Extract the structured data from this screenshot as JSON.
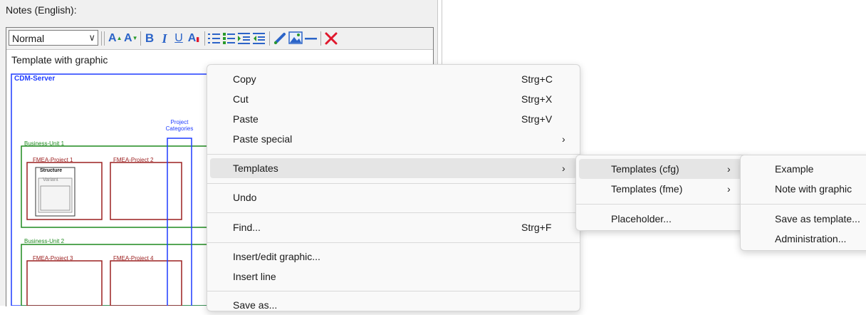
{
  "notes_label": "Notes (English):",
  "toolbar": {
    "style_value": "Normal",
    "grow_font": "A",
    "shrink_font": "A",
    "bold": "B",
    "italic": "I",
    "underline": "U",
    "font_color": "A",
    "icons": [
      "grow-font-icon",
      "shrink-font-icon",
      "bold-icon",
      "italic-icon",
      "underline-icon",
      "font-color-icon",
      "numbered-list-icon",
      "bullet-list-icon",
      "indent-icon",
      "outdent-icon",
      "link-icon",
      "insert-image-icon",
      "horizontal-line-icon",
      "delete-icon"
    ]
  },
  "document": {
    "text": "Template with graphic",
    "graphic": {
      "server": "CDM-Server",
      "project_categories": [
        "Project",
        "Categories"
      ],
      "bu1": "Business-Unit 1",
      "bu2": "Business-Unit 2",
      "p1": "FMEA-Project 1",
      "p2": "FMEA-Project 2",
      "p3": "FMEA-Project 3",
      "p4": "FMEA-Project 4",
      "structure": "Structure",
      "variant": "Variant"
    }
  },
  "context_menu": {
    "copy": {
      "label": "Copy",
      "shortcut": "Strg+C"
    },
    "cut": {
      "label": "Cut",
      "shortcut": "Strg+X"
    },
    "paste": {
      "label": "Paste",
      "shortcut": "Strg+V"
    },
    "paste_special": {
      "label": "Paste special",
      "arrow": "›"
    },
    "templates": {
      "label": "Templates",
      "arrow": "›"
    },
    "undo": {
      "label": "Undo"
    },
    "find": {
      "label": "Find...",
      "shortcut": "Strg+F"
    },
    "insert_graphic": {
      "label": "Insert/edit graphic..."
    },
    "insert_line": {
      "label": "Insert line"
    },
    "save_as": {
      "label": "Save as..."
    }
  },
  "templates_menu": {
    "cfg": {
      "label": "Templates (cfg)",
      "arrow": "›"
    },
    "fme": {
      "label": "Templates (fme)",
      "arrow": "›"
    },
    "placeholder": {
      "label": "Placeholder..."
    }
  },
  "cfg_menu": {
    "example": "Example",
    "note_with_graphic": "Note with graphic",
    "save_as_template": "Save as template...",
    "administration": "Administration..."
  },
  "colors": {
    "toolbar_blue": "#2c64c8",
    "server_blue": "#1f3cff",
    "bu_green": "#1f8a1f",
    "project_red": "#9c2020",
    "delete_red": "#e0182d",
    "menu_highlight": "#e5e5e5"
  }
}
